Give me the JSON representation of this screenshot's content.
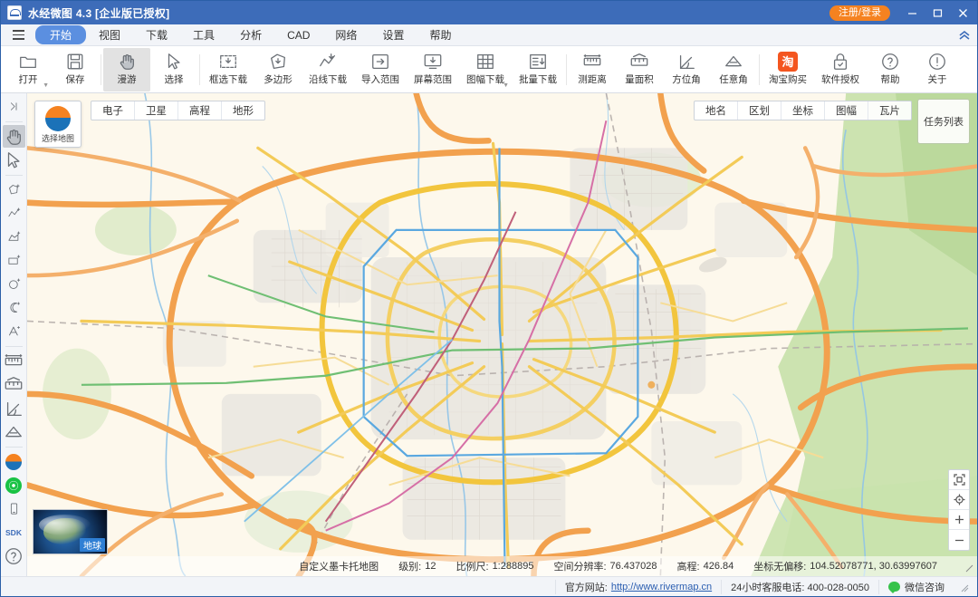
{
  "window": {
    "title": "水经微图 4.3 [企业版已授权]",
    "logo_icon": "rivermap-logo-icon",
    "login_label": "注册/登录",
    "minimize_icon": "minimize-icon",
    "maximize_icon": "maximize-icon",
    "close_icon": "close-icon",
    "titlebar_color": "#3d6cb9",
    "accent_orange": "#f58220"
  },
  "menubar": {
    "hamburger_icon": "hamburger-icon",
    "collapse_icon": "chevron-double-up-icon",
    "items": [
      {
        "label": "开始",
        "active": true
      },
      {
        "label": "视图",
        "active": false
      },
      {
        "label": "下载",
        "active": false
      },
      {
        "label": "工具",
        "active": false
      },
      {
        "label": "分析",
        "active": false
      },
      {
        "label": "CAD",
        "active": false
      },
      {
        "label": "网络",
        "active": false
      },
      {
        "label": "设置",
        "active": false
      },
      {
        "label": "帮助",
        "active": false
      }
    ]
  },
  "ribbon": {
    "items": [
      {
        "label": "打开",
        "icon": "folder-open-icon",
        "caret": true,
        "active": false
      },
      {
        "label": "保存",
        "icon": "save-disk-icon",
        "caret": false,
        "active": false
      },
      {
        "sep": true
      },
      {
        "label": "漫游",
        "icon": "hand-pan-icon",
        "caret": false,
        "active": true
      },
      {
        "label": "选择",
        "icon": "cursor-arrow-icon",
        "caret": false,
        "active": false
      },
      {
        "sep": true
      },
      {
        "label": "框选下载",
        "icon": "rect-download-icon",
        "caret": false,
        "active": false
      },
      {
        "label": "多边形",
        "icon": "polygon-download-icon",
        "caret": false,
        "active": false
      },
      {
        "label": "沿线下载",
        "icon": "polyline-download-icon",
        "caret": false,
        "active": false
      },
      {
        "label": "导入范围",
        "icon": "import-range-icon",
        "caret": false,
        "active": false
      },
      {
        "label": "屏幕范围",
        "icon": "screen-range-icon",
        "caret": false,
        "active": false
      },
      {
        "label": "图幅下载",
        "icon": "sheet-download-icon",
        "caret": true,
        "active": false
      },
      {
        "label": "批量下载",
        "icon": "batch-download-icon",
        "caret": false,
        "active": false
      },
      {
        "sep": true
      },
      {
        "label": "测距离",
        "icon": "measure-distance-icon",
        "caret": false,
        "active": false
      },
      {
        "label": "量面积",
        "icon": "measure-area-icon",
        "caret": false,
        "active": false
      },
      {
        "label": "方位角",
        "icon": "azimuth-icon",
        "caret": false,
        "active": false
      },
      {
        "label": "任意角",
        "icon": "arbitrary-angle-icon",
        "caret": false,
        "active": false
      },
      {
        "sep": true
      },
      {
        "label": "淘宝购买",
        "icon": "taobao-icon",
        "caret": false,
        "active": false
      },
      {
        "label": "软件授权",
        "icon": "lock-license-icon",
        "caret": false,
        "active": false
      },
      {
        "label": "帮助",
        "icon": "help-circle-icon",
        "caret": false,
        "active": false
      },
      {
        "label": "关于",
        "icon": "info-circle-icon",
        "caret": false,
        "active": false
      }
    ]
  },
  "left_rail": {
    "items": [
      {
        "icon": "expand-right-icon",
        "active": false
      },
      {
        "sep": true
      },
      {
        "icon": "hand-pan-icon",
        "active": true
      },
      {
        "icon": "cursor-arrow-icon",
        "active": false
      },
      {
        "sep": true
      },
      {
        "icon": "polygon-add-icon",
        "active": false
      },
      {
        "icon": "polyline-add-icon",
        "active": false
      },
      {
        "icon": "area-add-icon",
        "active": false
      },
      {
        "icon": "rectangle-add-icon",
        "active": false
      },
      {
        "icon": "circle-add-icon",
        "active": false
      },
      {
        "icon": "arc-add-icon",
        "active": false
      },
      {
        "icon": "text-label-icon",
        "active": false
      },
      {
        "sep": true
      },
      {
        "icon": "measure-distance-icon",
        "active": false
      },
      {
        "icon": "measure-area-icon",
        "active": false
      },
      {
        "icon": "azimuth-icon",
        "active": false
      },
      {
        "icon": "arbitrary-angle-icon",
        "active": false
      },
      {
        "sep": true
      },
      {
        "icon": "rivermap-logo-icon",
        "active": false
      },
      {
        "icon": "wechat-green-icon",
        "active": false
      },
      {
        "icon": "mobile-device-icon",
        "active": false
      },
      {
        "icon": "sdk-text-icon",
        "active": false
      },
      {
        "icon": "help-circle-icon",
        "active": false
      }
    ],
    "sdk_text": "SDK"
  },
  "map": {
    "picker": {
      "label": "选择地图",
      "icon": "rivermap-logo-icon"
    },
    "left_tabs": [
      "电子",
      "卫星",
      "高程",
      "地形"
    ],
    "right_tabs": [
      "地名",
      "区划",
      "坐标",
      "图幅",
      "瓦片"
    ],
    "task_button": "任务列表",
    "controls": [
      {
        "icon": "fit-extent-icon"
      },
      {
        "icon": "locate-crosshair-icon"
      },
      {
        "icon": "zoom-in-icon",
        "glyph": "+"
      },
      {
        "icon": "zoom-out-icon",
        "glyph": "−"
      }
    ],
    "earth_thumb": {
      "label": "地球",
      "icon": "globe-icon"
    }
  },
  "status": {
    "projection": "自定义墨卡托地图",
    "level_label": "级别:",
    "level_value": "12",
    "scale_label": "比例尺:",
    "scale_value": "1:288895",
    "resolution_label": "空间分辨率:",
    "resolution_value": "76.437028",
    "elevation_label": "高程:",
    "elevation_value": "426.84",
    "coord_label": "坐标无偏移:",
    "coord_value": "104.52078771, 30.63997607",
    "resize_icon": "resize-grip-icon"
  },
  "footer": {
    "site_label": "官方网站:",
    "site_url": "http://www.rivermap.cn",
    "phone_text": "24小时客服电话: 400-028-0050",
    "wechat_label": "微信咨询",
    "wechat_icon": "wechat-icon",
    "grip_icon": "resize-grip-icon"
  }
}
